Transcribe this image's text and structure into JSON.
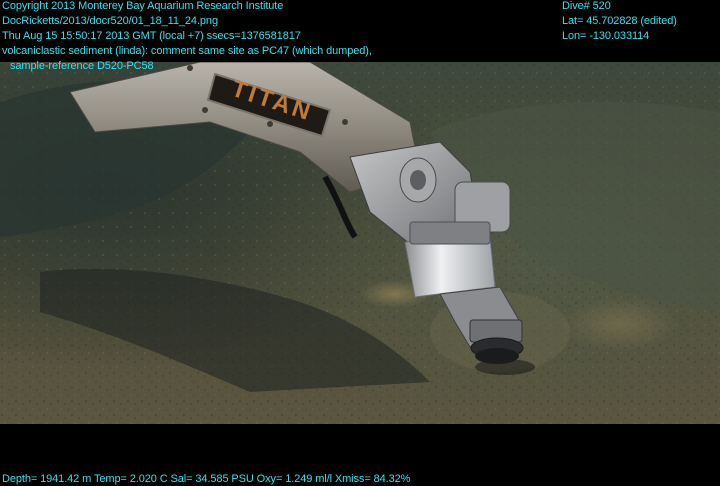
{
  "overlay": {
    "copyright": "Copyright 2013 Monterey Bay Aquarium Research Institute",
    "file_path": "DocRicketts/2013/docr520/01_18_11_24.png",
    "timestamp": "Thu Aug 15 15:50:17 2013 GMT (local +7)  ssecs=1376581817",
    "comment_line1": "volcaniclastic sediment (linda): comment same site as PC47 (which dumped),",
    "comment_line2": "sample-reference D520-PC58",
    "dive": "Dive# 520",
    "lat": "Lat= 45.702828 (edited)",
    "lon": "Lon= -130.033114",
    "sensors": "Depth= 1941.42 m  Temp= 2.020 C  Sal= 34.585 PSU  Oxy= 1.249 ml/l  Xmiss= 84.32%"
  },
  "arm": {
    "label": "TITAN"
  },
  "colors": {
    "overlay_text": "#29e6f2",
    "background": "#000000",
    "sediment": "#5a553f",
    "rock": "#2f3d37"
  }
}
